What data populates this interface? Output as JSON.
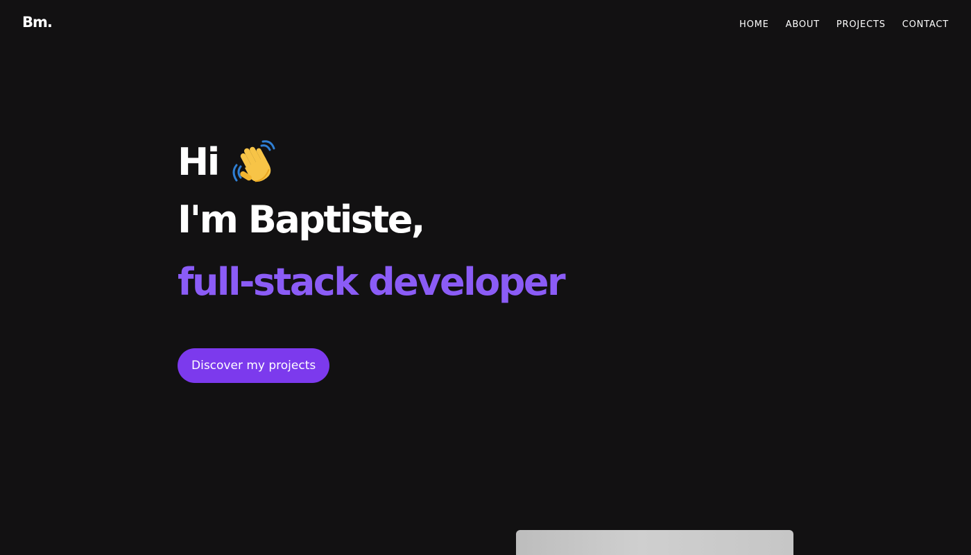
{
  "header": {
    "logo_text": "Bm.",
    "nav": [
      {
        "label": "HOME"
      },
      {
        "label": "ABOUT"
      },
      {
        "label": "PROJECTS"
      },
      {
        "label": "CONTACT"
      }
    ]
  },
  "hero": {
    "greeting": "Hi",
    "greeting_icon": "waving-hand-icon",
    "name_line": "I'm Baptiste,",
    "role_line": "full-stack developer",
    "cta_label": "Discover my projects"
  },
  "colors": {
    "background": "#121112",
    "text": "#ffffff",
    "accent": "#8b5cf6",
    "button": "#7c3aed"
  }
}
